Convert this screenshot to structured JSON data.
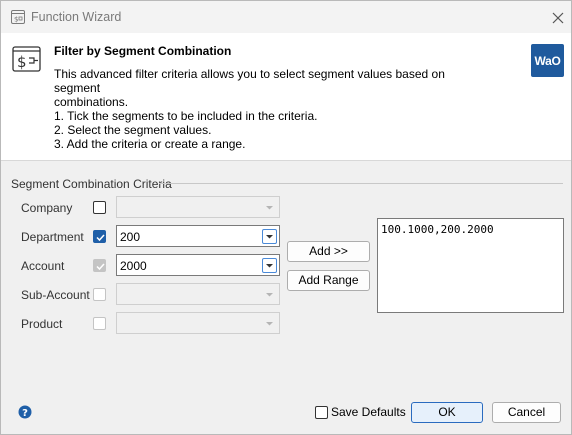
{
  "window": {
    "title": "Function Wizard"
  },
  "header": {
    "title": "Filter by Segment Combination",
    "description": [
      "This advanced filter criteria allows you to select segment values based on segment",
      "combinations.",
      "1. Tick the segments to be included in the criteria.",
      "2. Select the segment values.",
      "3. Add the criteria or create a range."
    ],
    "logo_text": "WaO",
    "logo_color": "#1f5a9d"
  },
  "criteria": {
    "group_label": "Segment Combination Criteria",
    "rows": [
      {
        "label": "Company",
        "checked": false,
        "check_disabled": false,
        "value": "",
        "combo_disabled": true
      },
      {
        "label": "Department",
        "checked": true,
        "check_disabled": false,
        "value": "200",
        "combo_disabled": false
      },
      {
        "label": "Account",
        "checked": true,
        "check_disabled": true,
        "value": "2000",
        "combo_disabled": false
      },
      {
        "label": "Sub-Account",
        "checked": false,
        "check_disabled": true,
        "value": "",
        "combo_disabled": true
      },
      {
        "label": "Product",
        "checked": false,
        "check_disabled": true,
        "value": "",
        "combo_disabled": true
      }
    ],
    "add_label": "Add >>",
    "add_range_label": "Add Range",
    "result_value": "100.1000,200.2000"
  },
  "footer": {
    "save_defaults_label": "Save Defaults",
    "ok_label": "OK",
    "cancel_label": "Cancel"
  },
  "colors": {
    "accent": "#1f5fa8",
    "help": "#1f5fa8"
  }
}
